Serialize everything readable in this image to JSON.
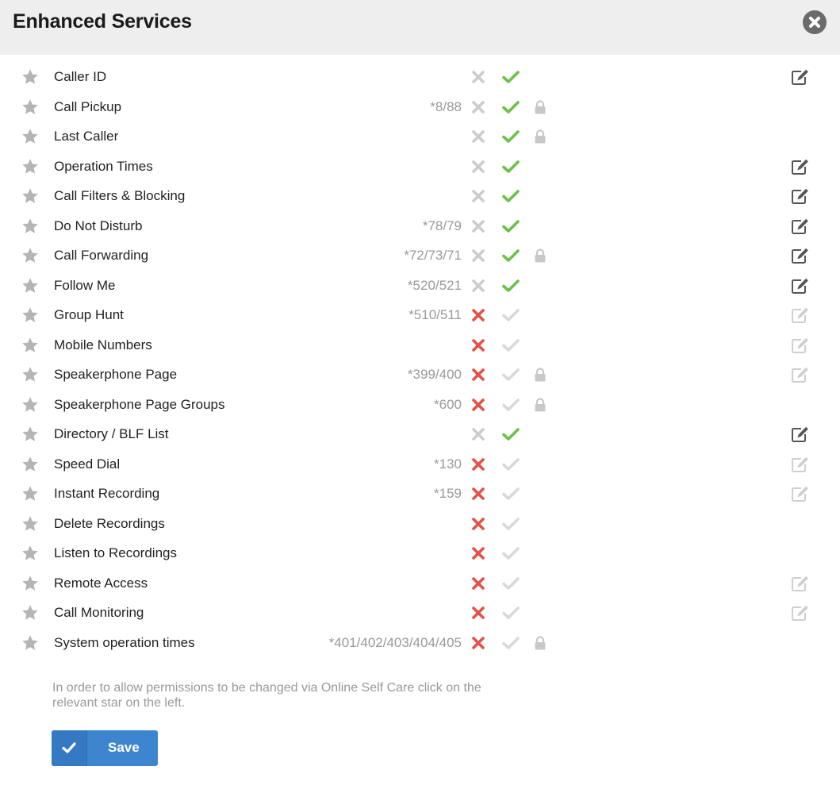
{
  "header": {
    "title": "Enhanced Services",
    "close_icon": "close-icon"
  },
  "colors": {
    "header_bg": "#eeeeee",
    "star": "#b5b5b5",
    "deny_active": "#e4504a",
    "deny_inactive": "#cccccc",
    "allow_active": "#6cc04a",
    "allow_inactive": "#d9d9d9",
    "lock": "#c8c8c8",
    "edit_active": "#555555",
    "edit_inactive": "#cfcfcf",
    "save_button": "#3d86cf"
  },
  "services": [
    {
      "label": "Caller ID",
      "code": "",
      "state": "allowed",
      "locked": false,
      "edit": "active"
    },
    {
      "label": "Call Pickup",
      "code": "*8/88",
      "state": "allowed",
      "locked": true,
      "edit": "none"
    },
    {
      "label": "Last Caller",
      "code": "",
      "state": "allowed",
      "locked": true,
      "edit": "none"
    },
    {
      "label": "Operation Times",
      "code": "",
      "state": "allowed",
      "locked": false,
      "edit": "active"
    },
    {
      "label": "Call Filters & Blocking",
      "code": "",
      "state": "allowed",
      "locked": false,
      "edit": "active"
    },
    {
      "label": "Do Not Disturb",
      "code": "*78/79",
      "state": "allowed",
      "locked": false,
      "edit": "active"
    },
    {
      "label": "Call Forwarding",
      "code": "*72/73/71",
      "state": "allowed",
      "locked": true,
      "edit": "active"
    },
    {
      "label": "Follow Me",
      "code": "*520/521",
      "state": "allowed",
      "locked": false,
      "edit": "active"
    },
    {
      "label": "Group Hunt",
      "code": "*510/511",
      "state": "denied",
      "locked": false,
      "edit": "inactive"
    },
    {
      "label": "Mobile Numbers",
      "code": "",
      "state": "denied",
      "locked": false,
      "edit": "inactive"
    },
    {
      "label": "Speakerphone Page",
      "code": "*399/400",
      "state": "denied",
      "locked": true,
      "edit": "inactive"
    },
    {
      "label": "Speakerphone Page Groups",
      "code": "*600",
      "state": "denied",
      "locked": true,
      "edit": "none"
    },
    {
      "label": "Directory / BLF List",
      "code": "",
      "state": "allowed",
      "locked": false,
      "edit": "active"
    },
    {
      "label": "Speed Dial",
      "code": "*130",
      "state": "denied",
      "locked": false,
      "edit": "inactive"
    },
    {
      "label": "Instant Recording",
      "code": "*159",
      "state": "denied",
      "locked": false,
      "edit": "inactive"
    },
    {
      "label": "Delete Recordings",
      "code": "",
      "state": "denied",
      "locked": false,
      "edit": "none"
    },
    {
      "label": "Listen to Recordings",
      "code": "",
      "state": "denied",
      "locked": false,
      "edit": "none"
    },
    {
      "label": "Remote Access",
      "code": "",
      "state": "denied",
      "locked": false,
      "edit": "inactive"
    },
    {
      "label": "Call Monitoring",
      "code": "",
      "state": "denied",
      "locked": false,
      "edit": "inactive"
    },
    {
      "label": "System operation times",
      "code": "*401/402/403/404/405",
      "state": "denied",
      "locked": true,
      "edit": "none"
    }
  ],
  "footer": {
    "note": "In order to allow permissions to be changed via Online Self Care click on the relevant star on the left.",
    "save_label": "Save",
    "save_icon": "checkmark-icon"
  }
}
